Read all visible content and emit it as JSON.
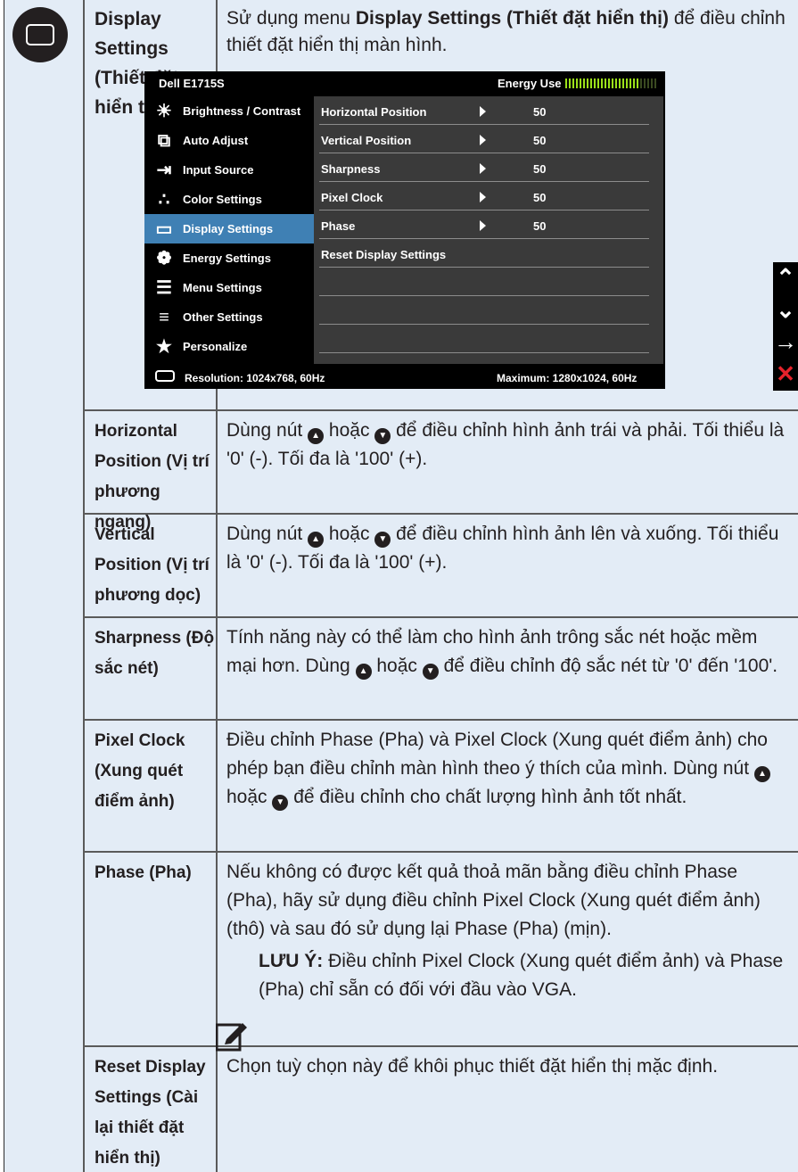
{
  "display_row": {
    "label": "Display Settings (Thiết đặt hiển thị)",
    "desc_pre": "Sử dụng menu ",
    "desc_bold": "Display Settings (Thiết đặt hiển thị)",
    "desc_post": " để điều chỉnh thiết đặt hiển thị màn hình."
  },
  "osd": {
    "title": "Dell E1715S",
    "energy_label": "Energy Use",
    "energy_level": 0.8,
    "menu": [
      {
        "label": "Brightness / Contrast",
        "icon": "brightness-icon"
      },
      {
        "label": "Auto Adjust",
        "icon": "auto-adjust-icon"
      },
      {
        "label": "Input Source",
        "icon": "input-source-icon"
      },
      {
        "label": "Color Settings",
        "icon": "color-settings-icon"
      },
      {
        "label": "Display Settings",
        "icon": "display-settings-icon"
      },
      {
        "label": "Energy Settings",
        "icon": "energy-settings-icon"
      },
      {
        "label": "Menu Settings",
        "icon": "menu-settings-icon"
      },
      {
        "label": "Other Settings",
        "icon": "other-settings-icon"
      },
      {
        "label": "Personalize",
        "icon": "star-icon"
      }
    ],
    "submenu": [
      {
        "label": "Horizontal Position",
        "value": "50"
      },
      {
        "label": "Vertical Position",
        "value": "50"
      },
      {
        "label": "Sharpness",
        "value": "50"
      },
      {
        "label": "Pixel Clock",
        "value": "50"
      },
      {
        "label": "Phase",
        "value": "50"
      },
      {
        "label": "Reset Display Settings",
        "value": ""
      }
    ],
    "resolution": "Resolution: 1024x768, 60Hz",
    "maximum": "Maximum: 1280x1024, 60Hz"
  },
  "side_buttons": [
    "up-arrow-icon",
    "down-arrow-icon",
    "right-arrow-icon",
    "close-icon"
  ],
  "rows": [
    {
      "label": "Horizontal Position (Vị trí phương ngang)",
      "d1": "Dùng nút ",
      "d2": " hoặc ",
      "d3": " để điều chỉnh hình ảnh trái và phải. Tối thiểu là '0' (-). Tối đa là '100' (+)."
    },
    {
      "label": "Vertical Position (Vị trí phương dọc)",
      "d1": "Dùng nút ",
      "d2": " hoặc ",
      "d3": " để điều chỉnh hình ảnh lên và xuống. Tối thiểu là '0' (-). Tối đa là '100' (+)."
    },
    {
      "label": "Sharpness (Độ sắc nét)",
      "d1": "Tính năng này có thể làm cho hình ảnh trông sắc nét hoặc mềm mại hơn. Dùng ",
      "d2": " hoặc ",
      "d3": " để điều chỉnh độ sắc nét từ '0' đến '100'."
    },
    {
      "label": "Pixel Clock (Xung quét điểm ảnh)",
      "d1": "Điều chỉnh Phase (Pha) và Pixel Clock (Xung quét điểm ảnh) cho phép bạn điều chỉnh màn hình theo ý thích của mình. Dùng nút ",
      "d2": " hoặc ",
      "d3": " để điều chỉnh cho chất lượng hình ảnh tốt nhất."
    },
    {
      "label": "Phase (Pha)",
      "d1": "Nếu không có được kết quả thoả mãn bằng điều chỉnh Phase (Pha), hãy sử dụng điều chỉnh Pixel Clock (Xung quét điểm ảnh) (thô) và sau đó sử dụng lại Phase (Pha) (mịn).",
      "note_bold": "LƯU Ý:",
      "note_text": " Điều chỉnh Pixel Clock (Xung quét điểm ảnh) và Phase (Pha) chỉ sẵn có đối với đầu vào VGA."
    },
    {
      "label": "Reset Display Settings (Cài lại thiết đặt hiển thị)",
      "d1": "Chọn tuỳ chọn này để khôi phục thiết đặt hiển thị mặc định."
    }
  ]
}
